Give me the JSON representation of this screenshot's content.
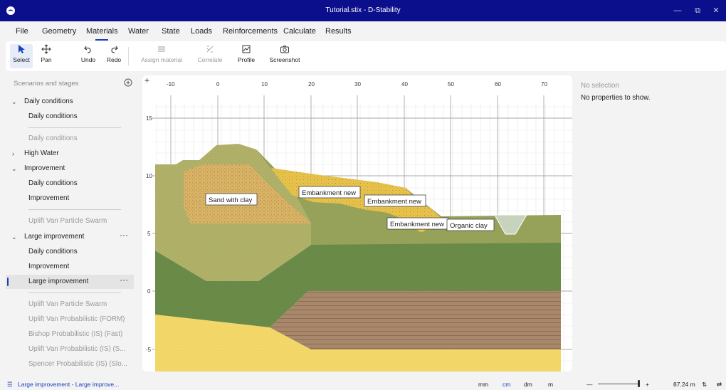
{
  "window": {
    "title": "Tutorial.stix - D-Stability",
    "minimize": "—",
    "maximize": "⧉",
    "close": "✕"
  },
  "menu": [
    "File",
    "Geometry",
    "Materials",
    "Water",
    "State",
    "Loads",
    "Reinforcements",
    "Calculate",
    "Results"
  ],
  "menu_active": "Materials",
  "toolbar": {
    "select": "Select",
    "pan": "Pan",
    "undo": "Undo",
    "redo": "Redo",
    "assign_material": "Assign material",
    "correlate": "Correlate",
    "profile": "Profile",
    "screenshot": "Screenshot"
  },
  "sidebar": {
    "header": "Scenarios and stages",
    "items": [
      {
        "label": "Daily conditions"
      },
      {
        "label": "Daily conditions"
      },
      {
        "label": "Daily conditions"
      },
      {
        "label": "High Water"
      },
      {
        "label": "Improvement"
      },
      {
        "label": "Daily conditions"
      },
      {
        "label": "Improvement"
      },
      {
        "label": "Uplift Van Particle Swarm"
      },
      {
        "label": "Large improvement"
      },
      {
        "label": "Daily conditions"
      },
      {
        "label": "Improvement"
      },
      {
        "label": "Large improvement"
      },
      {
        "label": "Uplift Van Particle Swarm"
      },
      {
        "label": "Uplift Van Probabilistic (FORM)"
      },
      {
        "label": "Bishop Probabilistic (IS) (Fast)"
      },
      {
        "label": "Uplift Van Probabilistic (IS) (S..."
      },
      {
        "label": "Spencer Probabilistic (IS) (Slo..."
      }
    ],
    "more": "···"
  },
  "canvas": {
    "x_ticks": [
      "-10",
      "0",
      "10",
      "20",
      "30",
      "40",
      "50",
      "60",
      "70"
    ],
    "y_ticks": [
      "15",
      "10",
      "5",
      "0",
      "-5"
    ],
    "plus": "+",
    "labels": {
      "sand_with_clay": "Sand with clay",
      "embankment_1": "Embankment new",
      "embankment_2": "Embankment new",
      "embankment_3": "Embankment new",
      "organic_clay": "Organic clay"
    }
  },
  "properties": {
    "header": "No selection",
    "message": "No properties to show."
  },
  "status": {
    "breadcrumb": "Large improvement - Large improve...",
    "units": [
      "mm",
      "cm",
      "dm",
      "m"
    ],
    "active_unit": "cm",
    "zoom_minus": "—",
    "zoom_plus": "+",
    "zoom_value": "87.24 m"
  },
  "colors": {
    "titlebar": "#0b0f8c",
    "accent": "#1a3fbf"
  }
}
